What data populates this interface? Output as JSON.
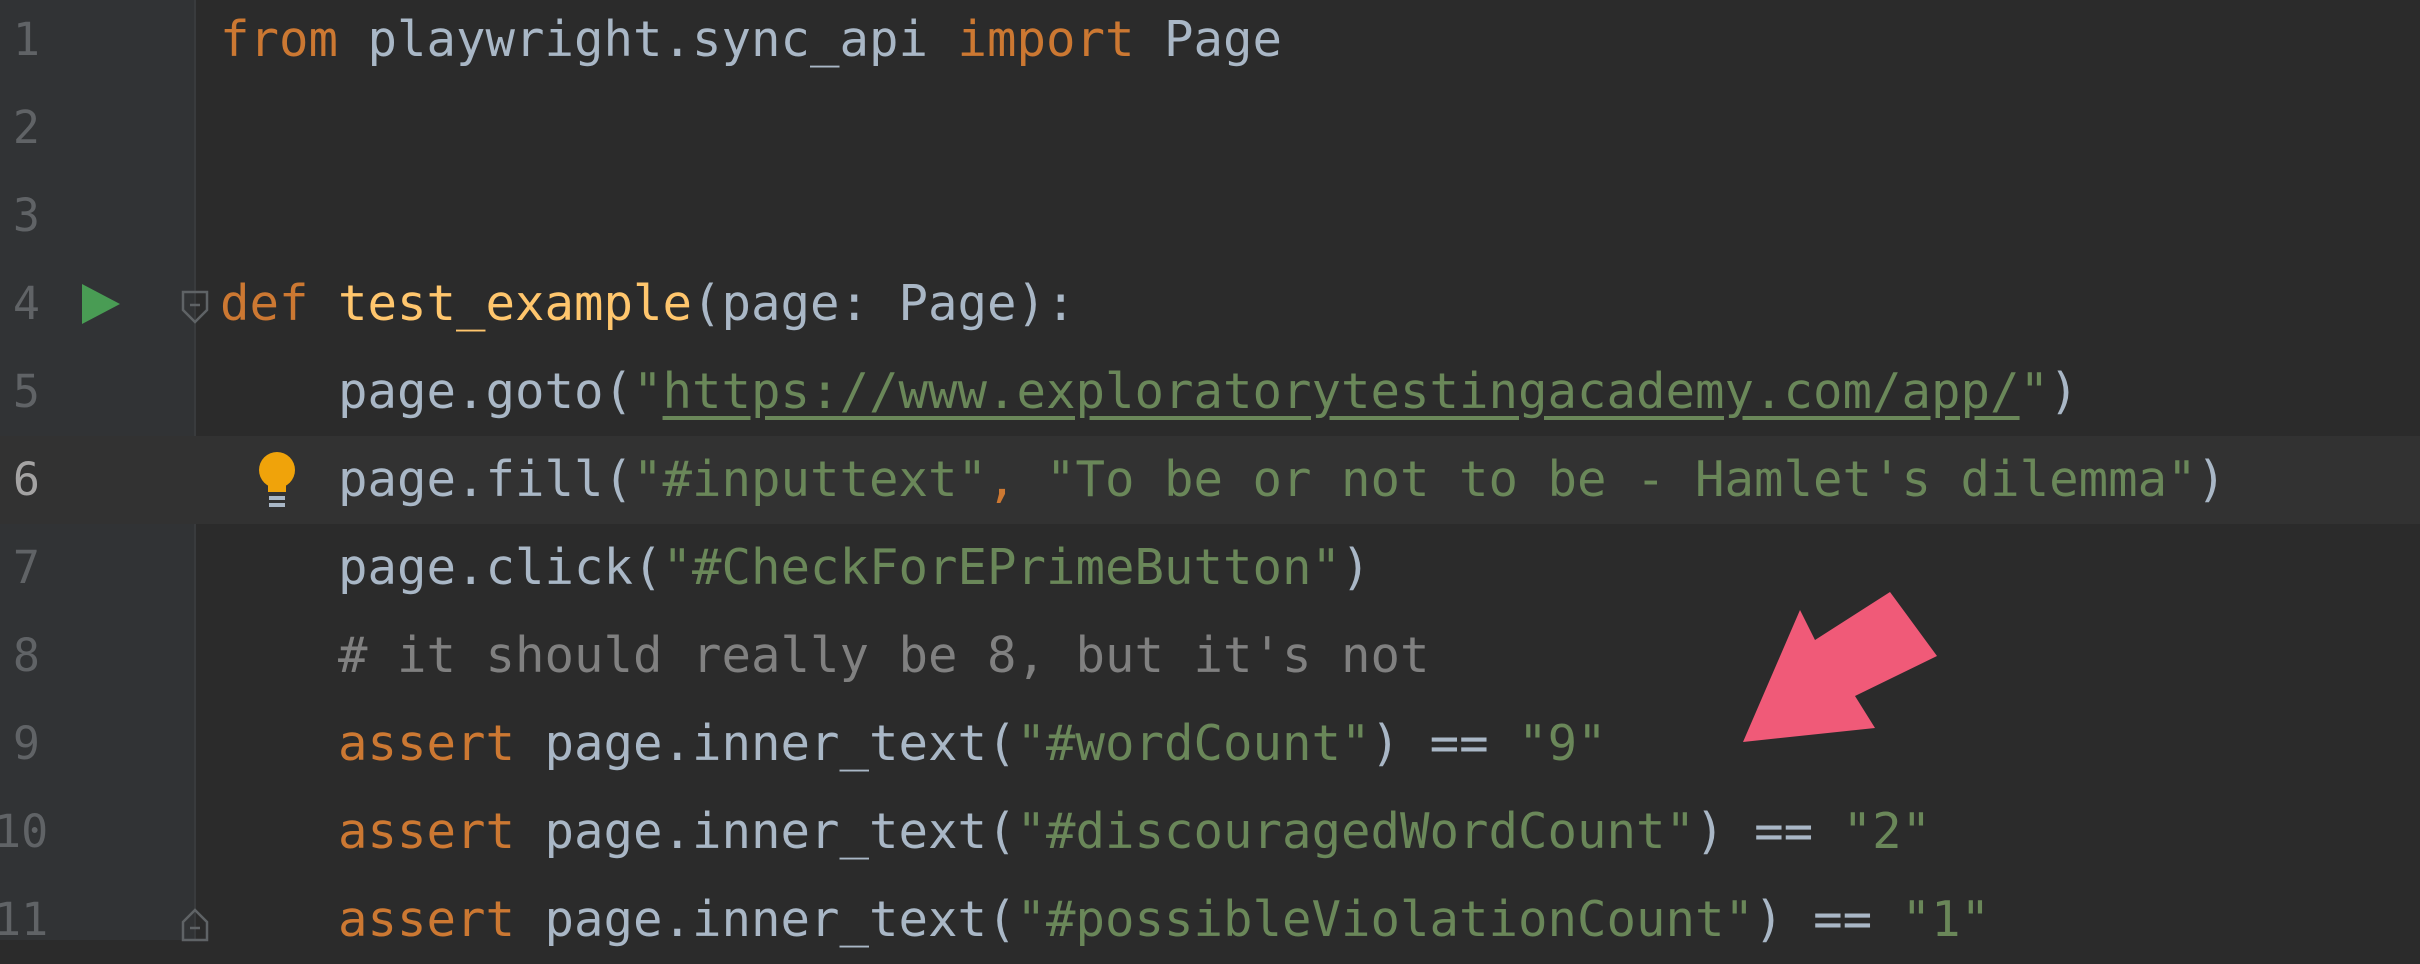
{
  "editor": {
    "lines": [
      {
        "number": "1",
        "tokens": [
          {
            "text": "from",
            "cls": "kw"
          },
          {
            "text": " playwright.sync_api ",
            "cls": ""
          },
          {
            "text": "import",
            "cls": "kw"
          },
          {
            "text": " Page",
            "cls": ""
          }
        ]
      },
      {
        "number": "2",
        "tokens": []
      },
      {
        "number": "3",
        "tokens": []
      },
      {
        "number": "4",
        "tokens": [
          {
            "text": "def",
            "cls": "kw"
          },
          {
            "text": " ",
            "cls": ""
          },
          {
            "text": "test_example",
            "cls": "fn"
          },
          {
            "text": "(page: Page):",
            "cls": ""
          }
        ]
      },
      {
        "number": "5",
        "tokens": [
          {
            "text": "    page.goto(",
            "cls": ""
          },
          {
            "text": "\"",
            "cls": "str"
          },
          {
            "text": "https://www.exploratorytestingacademy.com/app/",
            "cls": "url"
          },
          {
            "text": "\"",
            "cls": "str"
          },
          {
            "text": ")",
            "cls": ""
          }
        ]
      },
      {
        "number": "6",
        "tokens": [
          {
            "text": "    page.fill(",
            "cls": ""
          },
          {
            "text": "\"#inputtext\"",
            "cls": "str"
          },
          {
            "text": ", ",
            "cls": "kw"
          },
          {
            "text": "\"To be or not to be - Hamlet's dilemma\"",
            "cls": "str"
          },
          {
            "text": ")",
            "cls": ""
          }
        ]
      },
      {
        "number": "7",
        "tokens": [
          {
            "text": "    page.click(",
            "cls": ""
          },
          {
            "text": "\"#CheckForEPrimeButton\"",
            "cls": "str"
          },
          {
            "text": ")",
            "cls": ""
          }
        ]
      },
      {
        "number": "8",
        "tokens": [
          {
            "text": "    # it should really be 8, but it's not",
            "cls": "cm"
          }
        ]
      },
      {
        "number": "9",
        "tokens": [
          {
            "text": "    ",
            "cls": ""
          },
          {
            "text": "assert",
            "cls": "kw"
          },
          {
            "text": " page.inner_text(",
            "cls": ""
          },
          {
            "text": "\"#wordCount\"",
            "cls": "str"
          },
          {
            "text": ") == ",
            "cls": ""
          },
          {
            "text": "\"9\"",
            "cls": "str"
          }
        ]
      },
      {
        "number": "10",
        "tokens": [
          {
            "text": "    ",
            "cls": ""
          },
          {
            "text": "assert",
            "cls": "kw"
          },
          {
            "text": " page.inner_text(",
            "cls": ""
          },
          {
            "text": "\"#discouragedWordCount\"",
            "cls": "str"
          },
          {
            "text": ") == ",
            "cls": ""
          },
          {
            "text": "\"2\"",
            "cls": "str"
          }
        ]
      },
      {
        "number": "11",
        "tokens": [
          {
            "text": "    ",
            "cls": ""
          },
          {
            "text": "assert",
            "cls": "kw"
          },
          {
            "text": " page.inner_text(",
            "cls": ""
          },
          {
            "text": "\"#possibleViolationCount\"",
            "cls": "str"
          },
          {
            "text": ") == ",
            "cls": ""
          },
          {
            "text": "\"1\"",
            "cls": "str"
          }
        ]
      }
    ],
    "current_line": 6,
    "run_icon_line": 4,
    "bulb_icon_line": 6,
    "fold_icon_lines": [
      4,
      11
    ],
    "colors": {
      "background": "#2b2b2b",
      "keyword": "#cc7832",
      "function": "#ffc66d",
      "string": "#6a8759",
      "comment": "#808080",
      "default": "#a9b7c6",
      "run_icon": "#499c54",
      "bulb_icon": "#f0a30a",
      "arrow": "#f05a78"
    }
  },
  "annotation": {
    "icon": "pink-arrow-icon",
    "points_at_line": 9
  }
}
